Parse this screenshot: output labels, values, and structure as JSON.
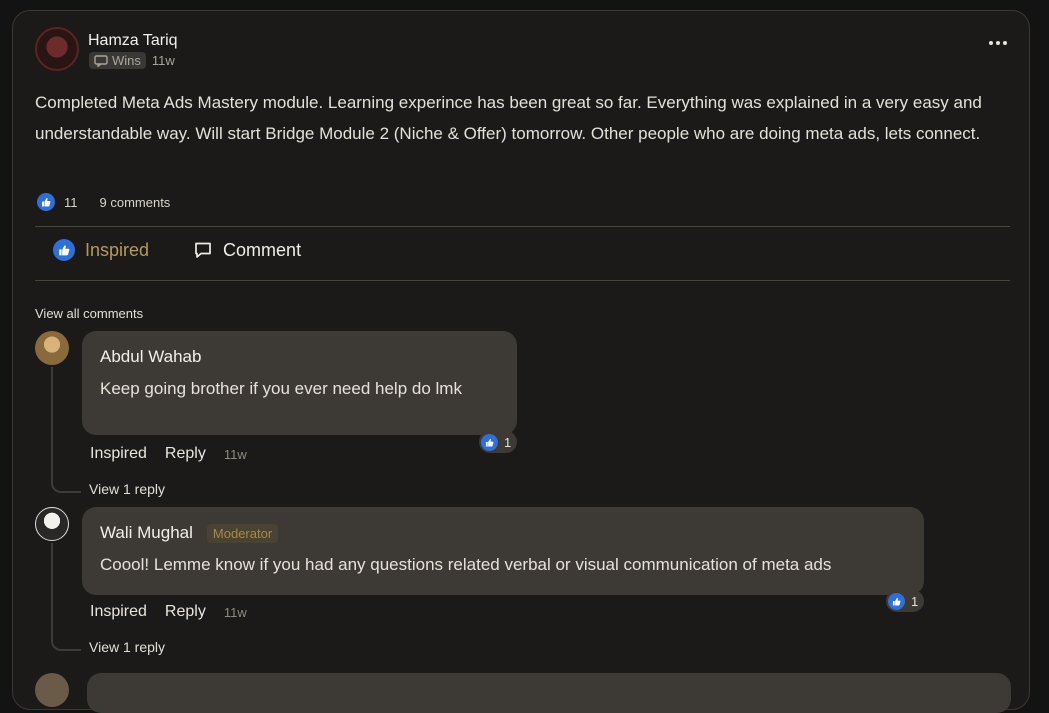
{
  "post": {
    "author": "Hamza Tariq",
    "badge": "Wins",
    "time": "11w",
    "text": "Completed Meta Ads Mastery module. Learning experince has been great so far. Everything was explained in a very easy and understandable way. Will start Bridge Module 2 (Niche & Offer) tomorrow. Other people who are doing meta ads, lets connect.",
    "likes": "11",
    "comments_count": "9 comments"
  },
  "actions": {
    "inspired": "Inspired",
    "comment": "Comment"
  },
  "view_all_comments": "View all comments",
  "comments": [
    {
      "name": "Abdul Wahab",
      "text": "Keep going brother if you ever need help do lmk",
      "reactions": "1",
      "inspired": "Inspired",
      "reply": "Reply",
      "time": "11w",
      "view_replies": "View 1 reply"
    },
    {
      "name": "Wali Mughal",
      "badge": "Moderator",
      "text": "Coool! Lemme know if you had any questions related verbal or visual communication of meta ads",
      "reactions": "1",
      "inspired": "Inspired",
      "reply": "Reply",
      "time": "11w",
      "view_replies": "View 1 reply"
    }
  ],
  "colors": {
    "background": "#131313",
    "card": "#1b1a19",
    "bubble": "#3d3a35",
    "accent_gold": "#b59a5b",
    "like_blue": "#2e6fd8"
  },
  "icons": {
    "badge": "chat-bubble-icon",
    "like": "thumbs-up-icon",
    "comment": "comment-icon",
    "more": "more-horizontal-icon"
  }
}
